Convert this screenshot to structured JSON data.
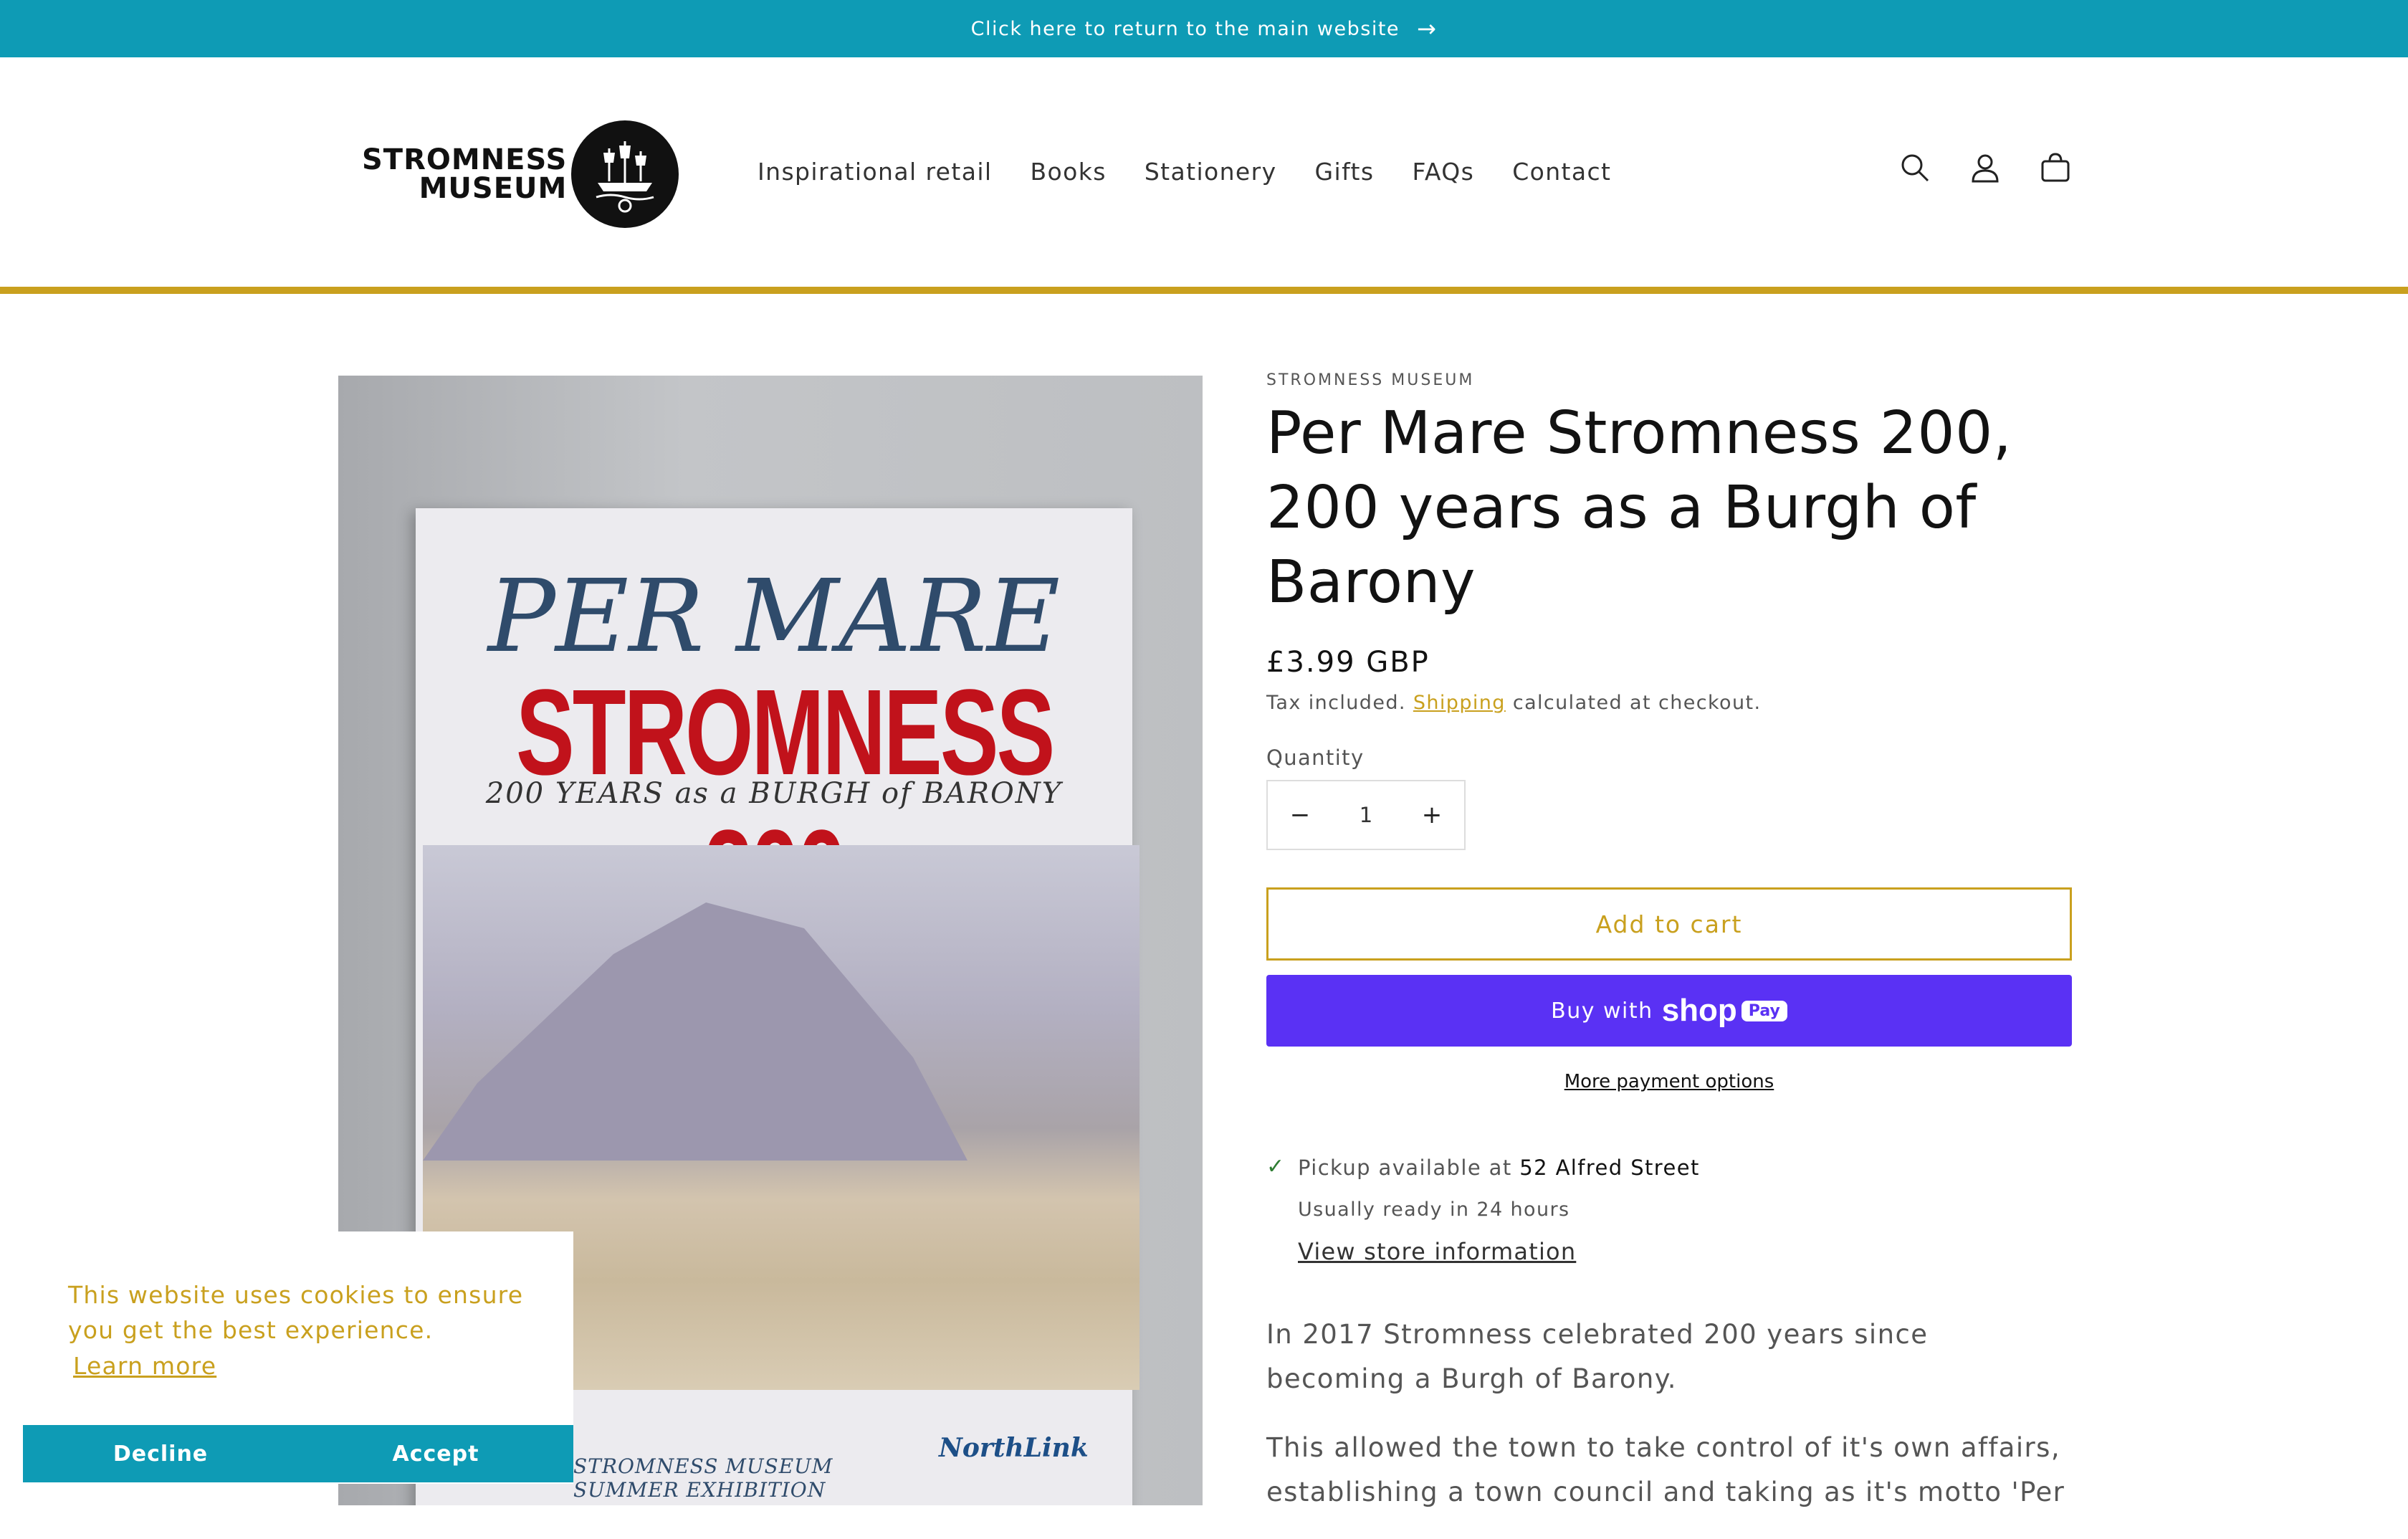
{
  "announcement": {
    "text": "Click here to return to the main website",
    "arrow_icon": "arrow-right-icon"
  },
  "logo": {
    "line1": "STROMNESS",
    "line2": "MUSEUM"
  },
  "nav": {
    "items": [
      "Inspirational retail",
      "Books",
      "Stationery",
      "Gifts",
      "FAQs",
      "Contact"
    ]
  },
  "header_icons": [
    "search-icon",
    "account-icon",
    "cart-icon"
  ],
  "colors": {
    "accent": "#0e9bb5",
    "gold": "#c9a01e",
    "shop_pay": "#5a31f4"
  },
  "product_image": {
    "title_line1": "PER MARE",
    "title_line2": "STROMNESS 200",
    "subtitle": "200 YEARS as a BURGH of BARONY",
    "footer_left_line1": "STROMNESS MUSEUM",
    "footer_left_line2": "SUMMER EXHIBITION",
    "footer_right": "NorthLink"
  },
  "product": {
    "vendor": "STROMNESS MUSEUM",
    "title": "Per Mare Stromness 200, 200 years as a Burgh of Barony",
    "price": "£3.99 GBP",
    "tax_prefix": "Tax included. ",
    "shipping_link": "Shipping",
    "tax_suffix": " calculated at checkout.",
    "quantity_label": "Quantity",
    "quantity_value": "1",
    "add_to_cart": "Add to cart",
    "buy_with": "Buy with",
    "shop_brand": "shop",
    "shop_pay_badge": "Pay",
    "more_payment": "More payment options",
    "pickup_prefix": "Pickup available at ",
    "pickup_location": "52 Alfred Street",
    "pickup_ready": "Usually ready in 24 hours",
    "view_store": "View store information",
    "description": [
      "In 2017 Stromness celebrated 200 years since becoming a Burgh of Barony.",
      "This allowed the town to take control of it's own affairs, establishing a town council and taking as it's motto 'Per"
    ]
  },
  "cookie": {
    "message": "This website uses cookies to ensure you get the best experience.",
    "learn_more": "Learn more",
    "decline": "Decline",
    "accept": "Accept"
  }
}
